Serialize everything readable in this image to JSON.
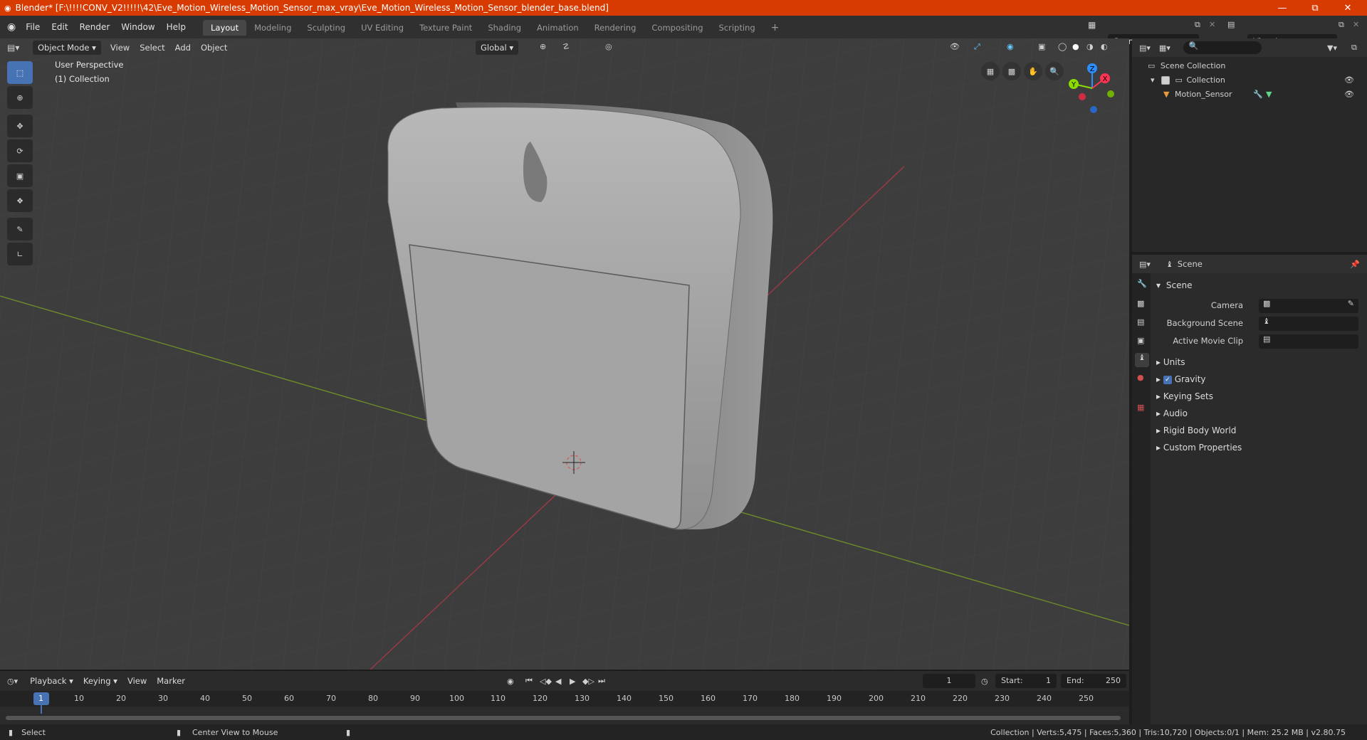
{
  "title_bar": {
    "title": "Blender* [F:\\!!!!CONV_V2!!!!!\\42\\Eve_Motion_Wireless_Motion_Sensor_max_vray\\Eve_Motion_Wireless_Motion_Sensor_blender_base.blend]",
    "bg_color": "#d83b01"
  },
  "menu": [
    "File",
    "Edit",
    "Render",
    "Window",
    "Help"
  ],
  "workspace_tabs": [
    "Layout",
    "Modeling",
    "Sculpting",
    "UV Editing",
    "Texture Paint",
    "Shading",
    "Animation",
    "Rendering",
    "Compositing",
    "Scripting"
  ],
  "active_workspace": "Layout",
  "scene_name": "Scene",
  "view_layer": "View Layer",
  "viewport": {
    "mode": "Object Mode",
    "menus": [
      "View",
      "Select",
      "Add",
      "Object"
    ],
    "transform_orientation": "Global",
    "overlay_title": "User Perspective",
    "overlay_collection": "(1) Collection",
    "gizmo_axes": [
      "X",
      "Y",
      "Z"
    ],
    "axis_colors": {
      "x": "#ff3352",
      "y": "#8bdc00",
      "z": "#2c8fff"
    }
  },
  "outliner": {
    "search_placeholder": "",
    "items": [
      {
        "label": "Scene Collection"
      },
      {
        "label": "Collection"
      },
      {
        "label": "Motion_Sensor"
      }
    ]
  },
  "properties": {
    "header": "Scene",
    "panel": "Scene",
    "fields": [
      {
        "label": "Camera"
      },
      {
        "label": "Background Scene"
      },
      {
        "label": "Active Movie Clip"
      }
    ],
    "sections": [
      {
        "label": "Units"
      },
      {
        "label": "Gravity",
        "checked": true
      },
      {
        "label": "Keying Sets"
      },
      {
        "label": "Audio"
      },
      {
        "label": "Rigid Body World"
      },
      {
        "label": "Custom Properties"
      }
    ]
  },
  "timeline": {
    "menus": [
      "Playback",
      "Keying",
      "View",
      "Marker"
    ],
    "current_frame": "1",
    "start_label": "Start:",
    "start": "1",
    "end_label": "End:",
    "end": "250",
    "ruler": [
      "1",
      "10",
      "20",
      "30",
      "40",
      "50",
      "60",
      "70",
      "80",
      "90",
      "100",
      "110",
      "120",
      "130",
      "140",
      "150",
      "160",
      "170",
      "180",
      "190",
      "200",
      "210",
      "220",
      "230",
      "240",
      "250"
    ]
  },
  "statusbar": {
    "left": "Select",
    "middle": "Center View to Mouse",
    "right": "Collection | Verts:5,475 | Faces:5,360 | Tris:10,720 | Objects:0/1 | Mem: 25.2 MB | v2.80.75"
  }
}
